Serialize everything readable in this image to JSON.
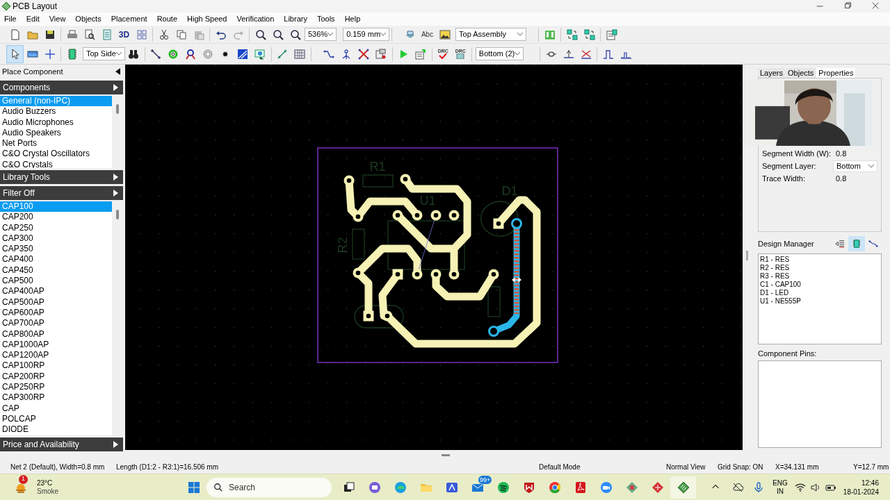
{
  "window": {
    "title": "PCB Layout"
  },
  "menu": [
    "File",
    "Edit",
    "View",
    "Objects",
    "Placement",
    "Route",
    "High Speed",
    "Verification",
    "Library",
    "Tools",
    "Help"
  ],
  "toolbar_1": {
    "button_3d": "3D",
    "zoom": "536%",
    "grid_size": "0.159 mm",
    "text_button": "Abc",
    "view_layer": "Top Assembly"
  },
  "toolbar_2": {
    "select_active": true,
    "side": "Top Side",
    "drc_labels": [
      "DRC",
      "DRC"
    ],
    "route_layer": "Bottom (2)"
  },
  "left_panel": {
    "title": "Place Component",
    "sections": [
      {
        "title": "Components",
        "items": [
          {
            "label": "General (non-IPC)",
            "selected": true
          },
          {
            "label": "Audio Buzzers",
            "selected": false
          },
          {
            "label": "Audio Microphones",
            "selected": false
          },
          {
            "label": "Audio Speakers",
            "selected": false
          },
          {
            "label": "Net Ports",
            "selected": false
          },
          {
            "label": "C&O Crystal Oscillators",
            "selected": false
          },
          {
            "label": "C&O Crystals",
            "selected": false
          }
        ]
      },
      {
        "title": "Library Tools"
      },
      {
        "title": "Filter Off",
        "items": [
          {
            "label": "CAP100",
            "selected": true
          },
          {
            "label": "CAP200",
            "selected": false
          },
          {
            "label": "CAP250",
            "selected": false
          },
          {
            "label": "CAP300",
            "selected": false
          },
          {
            "label": "CAP350",
            "selected": false
          },
          {
            "label": "CAP400",
            "selected": false
          },
          {
            "label": "CAP450",
            "selected": false
          },
          {
            "label": "CAP500",
            "selected": false
          },
          {
            "label": "CAP400AP",
            "selected": false
          },
          {
            "label": "CAP500AP",
            "selected": false
          },
          {
            "label": "CAP600AP",
            "selected": false
          },
          {
            "label": "CAP700AP",
            "selected": false
          },
          {
            "label": "CAP800AP",
            "selected": false
          },
          {
            "label": "CAP1000AP",
            "selected": false
          },
          {
            "label": "CAP1200AP",
            "selected": false
          },
          {
            "label": "CAP100RP",
            "selected": false
          },
          {
            "label": "CAP200RP",
            "selected": false
          },
          {
            "label": "CAP250RP",
            "selected": false
          },
          {
            "label": "CAP300RP",
            "selected": false
          },
          {
            "label": "CAP",
            "selected": false
          },
          {
            "label": "POLCAP",
            "selected": false
          },
          {
            "label": "DIODE",
            "selected": false
          }
        ]
      },
      {
        "title": "Price and Availability"
      }
    ]
  },
  "board": {
    "labels": [
      "R1",
      "U1",
      "D1",
      "R2"
    ]
  },
  "right_panel": {
    "tabs": [
      {
        "label": "Layers",
        "selected": false
      },
      {
        "label": "Objects",
        "selected": false
      },
      {
        "label": "Properties",
        "selected": true
      }
    ],
    "properties": [
      {
        "label": "Segment Width (W):",
        "value": "0.8",
        "kind": "text"
      },
      {
        "label": "Segment Layer:",
        "value": "Bottom",
        "kind": "dropdown"
      },
      {
        "label": "Trace Width:",
        "value": "0.8",
        "kind": "text"
      }
    ],
    "design_manager": {
      "title": "Design Manager",
      "view_buttons": [
        {
          "selected": false
        },
        {
          "selected": true
        },
        {
          "selected": false
        }
      ],
      "items": [
        "R1 - RES",
        "R2 - RES",
        "R3 - RES",
        "C1 - CAP100",
        "D1 - LED",
        "U1 - NE555P"
      ]
    },
    "component_pins": {
      "label": "Component Pins:"
    }
  },
  "status_bar": {
    "net": "Net 2 (Default), Width=0.8 mm",
    "length": "Length (D1:2 - R3:1)=16.506 mm",
    "mode": "Default Mode",
    "view": "Normal View",
    "grid_snap": "Grid Snap: ON",
    "x": "X=34.131 mm",
    "y": "Y=12.7 mm"
  },
  "taskbar": {
    "weather_badge": "1",
    "temperature": "23°C",
    "condition": "Smoke",
    "search": "Search",
    "mail_badge": "99+",
    "language": "ENG",
    "region": "IN",
    "time": "12:46",
    "date": "18-01-2024"
  }
}
